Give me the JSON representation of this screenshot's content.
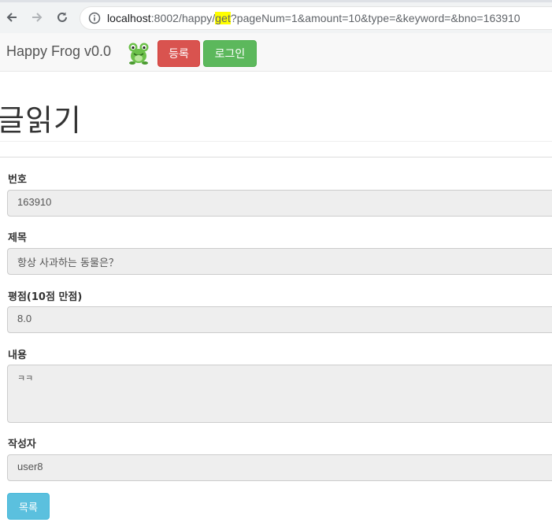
{
  "browser": {
    "url_host": "localhost",
    "url_port_path_pre": ":8002/happy/",
    "url_highlight": "get",
    "url_query": "?pageNum=1&amount=10&type=&keyword=&bno=163910"
  },
  "navbar": {
    "brand": "Happy Frog v0.0",
    "register_label": "등록",
    "login_label": "로그인"
  },
  "page": {
    "title": "글읽기"
  },
  "form": {
    "bno_label": "번호",
    "bno_value": "163910",
    "title_label": "제목",
    "title_value": "항상 사과하는 동물은？",
    "rating_label": "평점(10점 만점)",
    "rating_value": "8.0",
    "content_label": "내용",
    "content_value": "ㅋㅋ",
    "writer_label": "작성자",
    "writer_value": "user8",
    "list_label": "목록"
  },
  "colors": {
    "danger": "#d9534f",
    "success": "#5cb85c",
    "info": "#5bc0de",
    "highlight": "#ffff00"
  }
}
